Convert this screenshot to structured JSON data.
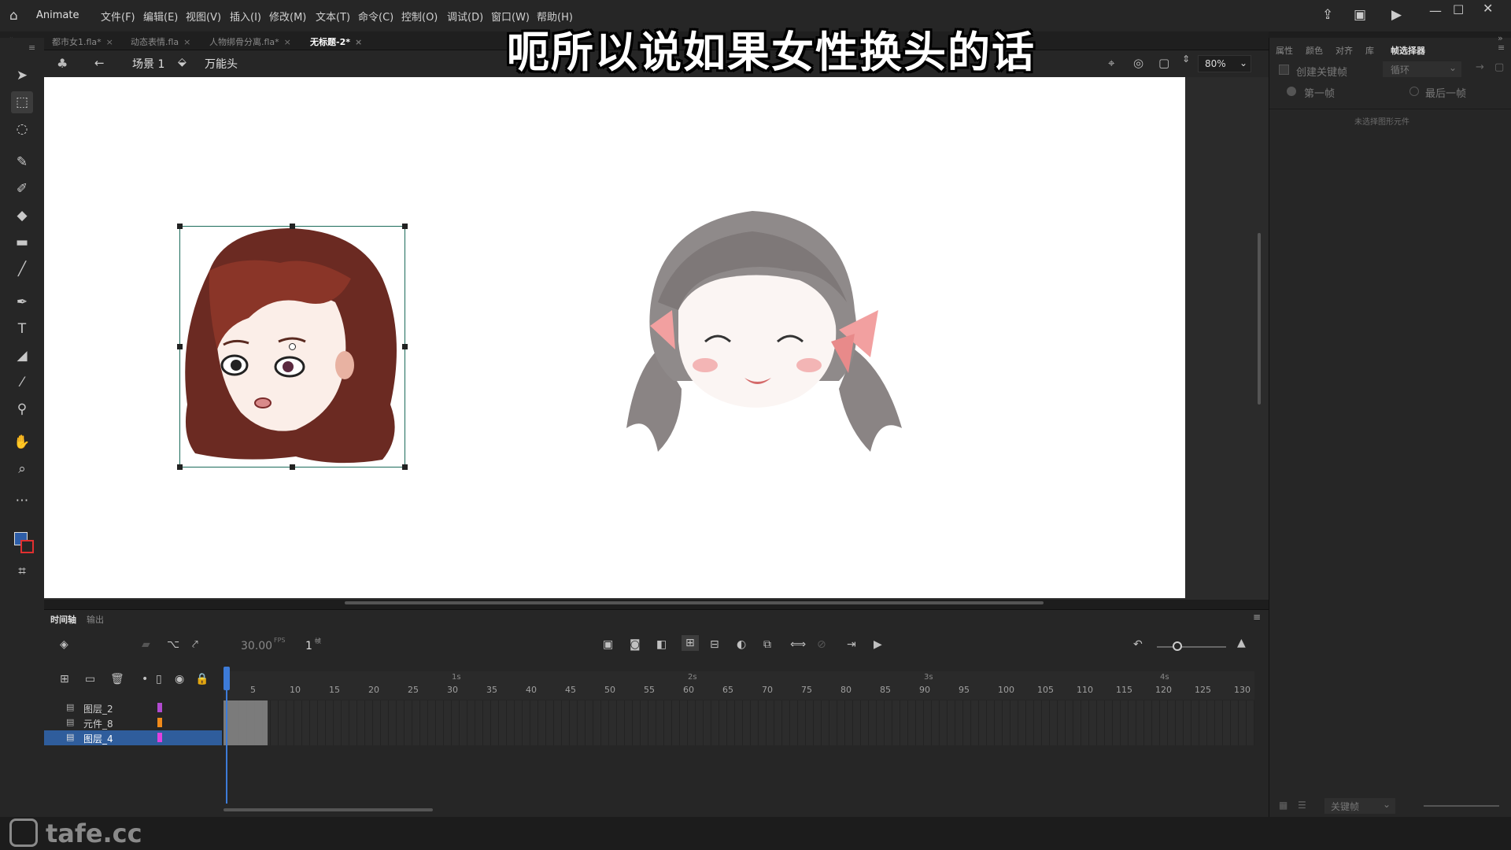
{
  "app": {
    "name": "Animate"
  },
  "menu": [
    "文件(F)",
    "编辑(E)",
    "视图(V)",
    "插入(I)",
    "修改(M)",
    "文本(T)",
    "命令(C)",
    "控制(O)",
    "调试(D)",
    "窗口(W)",
    "帮助(H)"
  ],
  "doc_tabs": [
    {
      "label": "都市女1.fla*",
      "active": false
    },
    {
      "label": "动态表情.fla",
      "active": false
    },
    {
      "label": "人物绑骨分离.fla*",
      "active": false
    },
    {
      "label": "无标题-2*",
      "active": true
    }
  ],
  "edit_bar": {
    "scene": "场景 1",
    "symbol": "万能头",
    "zoom": "80%"
  },
  "subtitle": "呃所以说如果女性换头的话",
  "props_panel": {
    "tabs": [
      "属性",
      "颜色",
      "对齐",
      "库",
      "帧选择器"
    ],
    "create_keyframe": "创建关键帧",
    "loop_option": "循环",
    "first_frame": "第一帧",
    "last_frame": "最后一帧",
    "empty_msg": "未选择图形元件",
    "footer_select": "关键帧"
  },
  "timeline": {
    "tabs": [
      "时间轴",
      "输出"
    ],
    "fps": "30.00",
    "fps_unit": "FPS",
    "current_frame": "1",
    "frame_unit": "帧",
    "seconds": [
      "1s",
      "2s",
      "3s",
      "4s"
    ],
    "frame_numbers": [
      "5",
      "10",
      "15",
      "20",
      "25",
      "30",
      "35",
      "40",
      "45",
      "50",
      "55",
      "60",
      "65",
      "70",
      "75",
      "80",
      "85",
      "90",
      "95",
      "100",
      "105",
      "110",
      "115",
      "120",
      "125",
      "130"
    ],
    "layers": [
      {
        "name": "图层_2",
        "color": "#b14ad0",
        "selected": false
      },
      {
        "name": "元件_8",
        "color": "#f08a1a",
        "selected": false
      },
      {
        "name": "图层_4",
        "color": "#e040e0",
        "selected": true
      }
    ]
  },
  "watermark": "tafe.cc"
}
